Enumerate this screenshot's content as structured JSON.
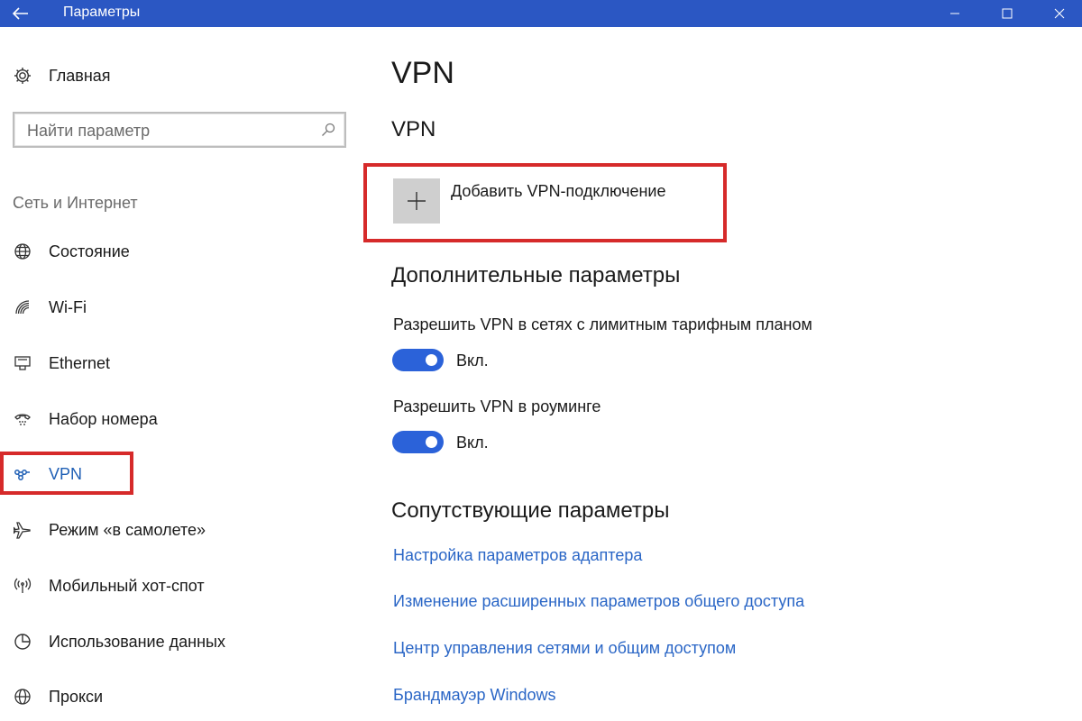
{
  "window": {
    "title": "Параметры",
    "accent": "#2b57c3"
  },
  "sidebar": {
    "home_label": "Главная",
    "search_placeholder": "Найти параметр",
    "section_label": "Сеть и Интернет",
    "items": [
      {
        "label": "Состояние",
        "icon": "globe-icon"
      },
      {
        "label": "Wi-Fi",
        "icon": "wifi-icon"
      },
      {
        "label": "Ethernet",
        "icon": "ethernet-icon"
      },
      {
        "label": "Набор номера",
        "icon": "dialup-icon"
      },
      {
        "label": "VPN",
        "icon": "vpn-icon",
        "active": true
      },
      {
        "label": "Режим «в самолете»",
        "icon": "airplane-icon"
      },
      {
        "label": "Мобильный хот-спот",
        "icon": "hotspot-icon"
      },
      {
        "label": "Использование данных",
        "icon": "data-usage-icon"
      },
      {
        "label": "Прокси",
        "icon": "proxy-globe-icon"
      }
    ]
  },
  "main": {
    "page_title": "VPN",
    "vpn_section_title": "VPN",
    "add_vpn_label": "Добавить VPN-подключение",
    "advanced_title": "Дополнительные параметры",
    "options": [
      {
        "label": "Разрешить VPN в сетях с лимитным тарифным планом",
        "state": "Вкл.",
        "on": true
      },
      {
        "label": "Разрешить VPN в роуминге",
        "state": "Вкл.",
        "on": true
      }
    ],
    "related_title": "Сопутствующие параметры",
    "related_links": [
      "Настройка параметров адаптера",
      "Изменение расширенных параметров общего доступа",
      "Центр управления сетями и общим доступом",
      "Брандмауэр Windows"
    ]
  },
  "colors": {
    "link": "#2a66c6",
    "toggle_on": "#2b62d9",
    "highlight": "#d62a2a"
  }
}
